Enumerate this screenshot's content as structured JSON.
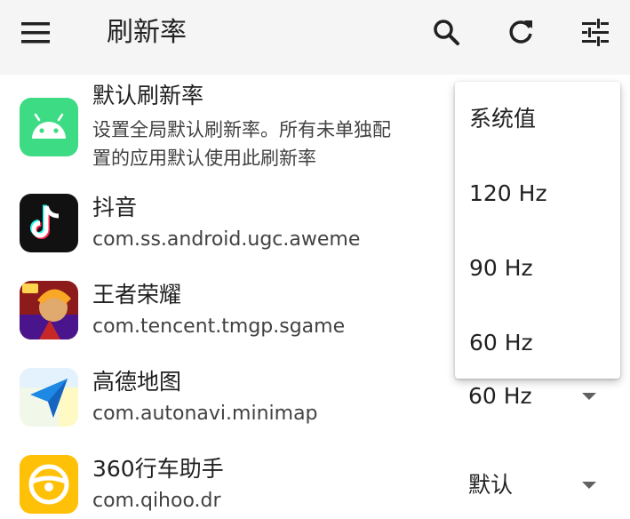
{
  "appbar": {
    "title": "刷新率",
    "menu_icon": "menu-icon",
    "actions": [
      {
        "icon": "search-icon"
      },
      {
        "icon": "refresh-icon"
      },
      {
        "icon": "tune-icon"
      }
    ]
  },
  "rows": [
    {
      "icon": "android-icon",
      "name": "默认刷新率",
      "desc_line1": "设置全局默认刷新率。所有未单独配",
      "desc_line2": "置的应用默认使用此刷新率",
      "value": ""
    },
    {
      "icon": "douyin-icon",
      "name": "抖音",
      "desc_line1": "com.ss.android.ugc.aweme",
      "value": ""
    },
    {
      "icon": "honor-of-kings-icon",
      "name": "王者荣耀",
      "desc_line1": "com.tencent.tmgp.sgame",
      "value": ""
    },
    {
      "icon": "amap-icon",
      "name": "高德地图",
      "desc_line1": "com.autonavi.minimap",
      "value": "60 Hz"
    },
    {
      "icon": "360-car-assistant-icon",
      "name": "360行车助手",
      "desc_line1": "com.qihoo.dr",
      "value": "默认"
    }
  ],
  "dropdown": {
    "options": [
      "系统值",
      "120 Hz",
      "90 Hz",
      "60 Hz"
    ]
  },
  "colors": {
    "appbar_bg": "#f5f5f5",
    "android_green": "#3ddc84",
    "douyin_bg": "#111111",
    "douyin_cyan": "#25f4ee",
    "douyin_pink": "#fe2c55",
    "amap_blue": "#1e88e5",
    "car_yellow": "#ffc107"
  }
}
